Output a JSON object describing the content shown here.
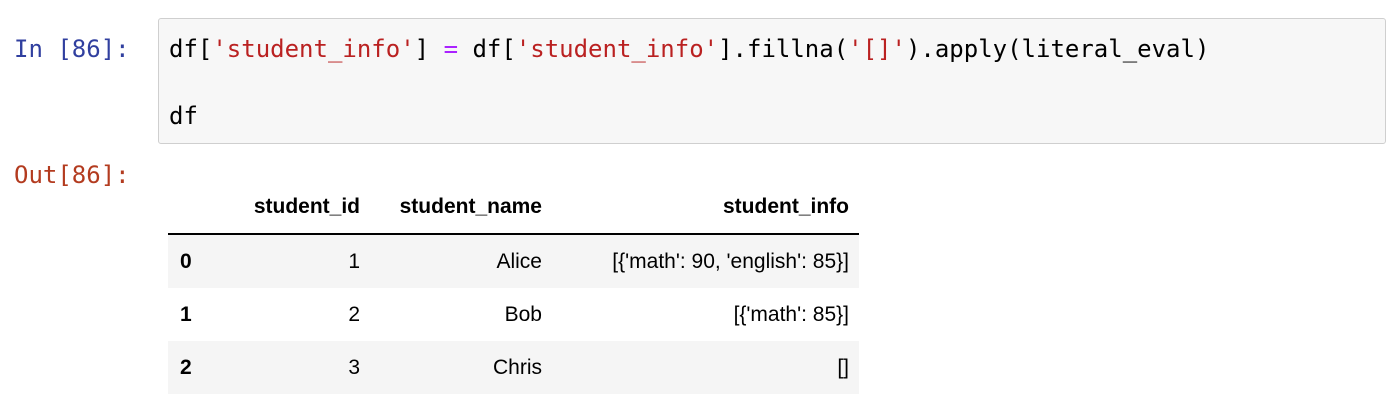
{
  "cell": {
    "input_prompt": "In [86]:",
    "output_prompt": "Out[86]:",
    "code": {
      "line1": {
        "t1": "df[",
        "t2": "'student_info'",
        "t3": "] ",
        "t4": "=",
        "t5": " df[",
        "t6": "'student_info'",
        "t7": "].fillna(",
        "t8": "'[]'",
        "t9": ").apply(literal_eval)"
      },
      "line2": "df"
    },
    "colors": {
      "string": "#ba2121",
      "operator": "#aa22ff",
      "in_prompt": "#303f9f",
      "out_prompt": "#b33b1f"
    }
  },
  "dataframe": {
    "columns": [
      "",
      "student_id",
      "student_name",
      "student_info"
    ],
    "rows": [
      {
        "index": "0",
        "student_id": "1",
        "student_name": "Alice",
        "student_info": "[{'math': 90, 'english': 85}]"
      },
      {
        "index": "1",
        "student_id": "2",
        "student_name": "Bob",
        "student_info": "[{'math': 85}]"
      },
      {
        "index": "2",
        "student_id": "3",
        "student_name": "Chris",
        "student_info": "[]"
      }
    ]
  }
}
